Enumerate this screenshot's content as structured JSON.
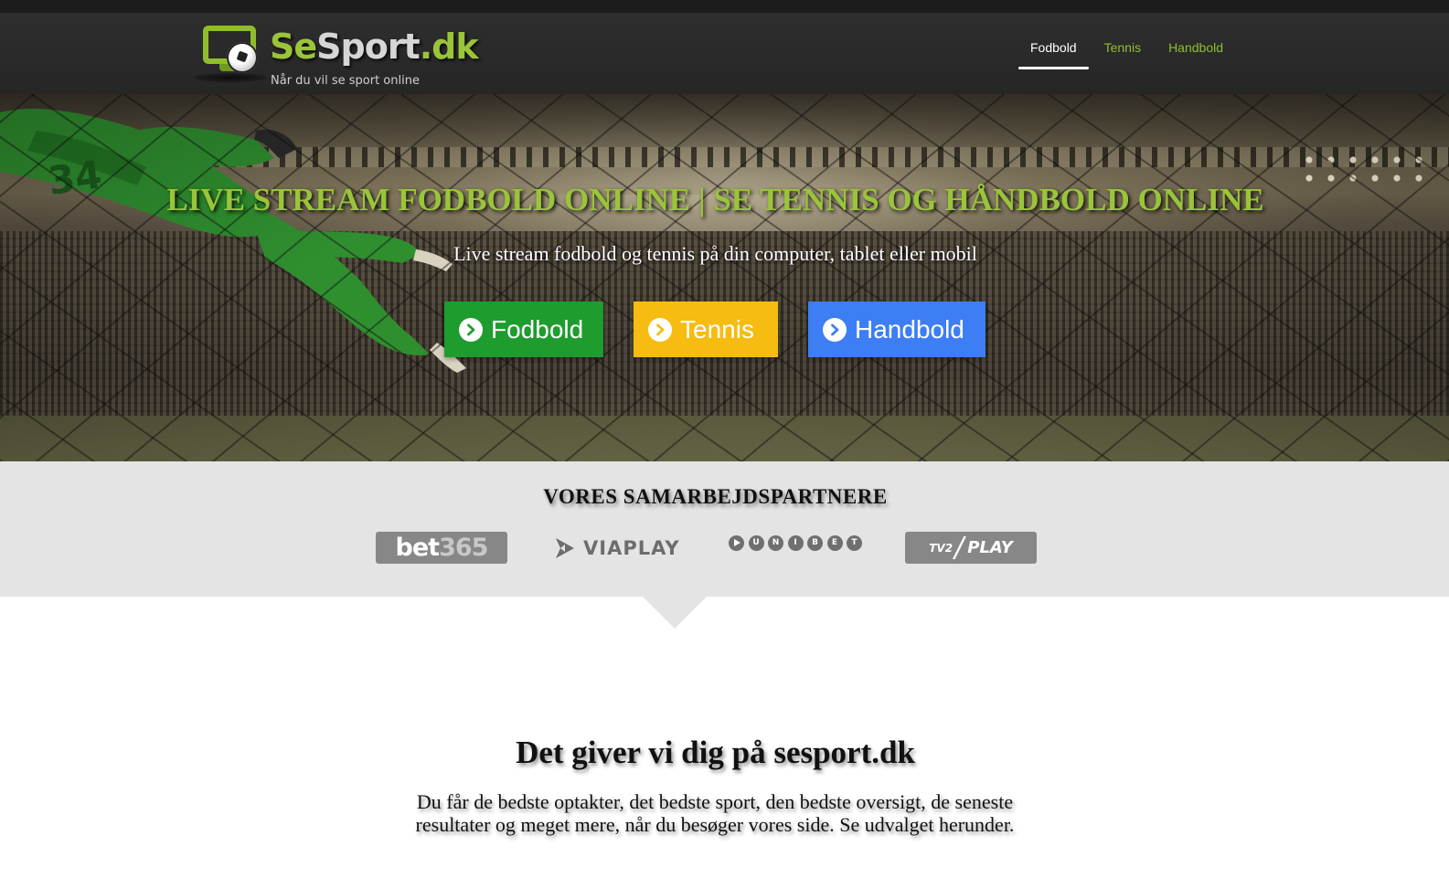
{
  "header": {
    "logo": {
      "text_se": "Se",
      "text_sport": "Sport",
      "text_dk": ".dk",
      "tagline": "Når du vil se sport online"
    },
    "nav": [
      {
        "label": "Fodbold",
        "active": true
      },
      {
        "label": "Tennis",
        "active": false
      },
      {
        "label": "Handbold",
        "active": false
      }
    ]
  },
  "hero": {
    "title": "LIVE STREAM FODBOLD ONLINE | SE TENNIS OG HÅNDBOLD ONLINE",
    "subtitle": "Live stream fodbold og tennis på din computer, tablet eller mobil",
    "buttons": [
      {
        "label": "Fodbold",
        "color": "#1e9c2e",
        "icon": "chevron-right-circle-icon"
      },
      {
        "label": "Tennis",
        "color": "#f6bc12",
        "icon": "chevron-right-circle-icon"
      },
      {
        "label": "Handbold",
        "color": "#3d7ef5",
        "icon": "chevron-right-circle-icon"
      }
    ]
  },
  "partners": {
    "title": "VORES SAMARBEJDSPARTNERE",
    "logos": {
      "bet365": {
        "part1": "bet",
        "part2": "365"
      },
      "viaplay": {
        "text": "VIAPLAY"
      },
      "unibet": {
        "letters": [
          "U",
          "N",
          "I",
          "B",
          "E",
          "T"
        ]
      },
      "tv2play": {
        "tv2": "TV2",
        "slash": "/",
        "play": "PLAY"
      }
    }
  },
  "content": {
    "title": "Det giver vi dig på sesport.dk",
    "text": "Du får de bedste optakter, det bedste sport, den bedste oversigt, de seneste resultater og meget mere, når du besøger vores side. Se udvalget herunder."
  },
  "colors": {
    "brand_green": "#9ac43a",
    "header_bg": "#2b2b2b",
    "partners_bg": "#e4e4e4"
  }
}
